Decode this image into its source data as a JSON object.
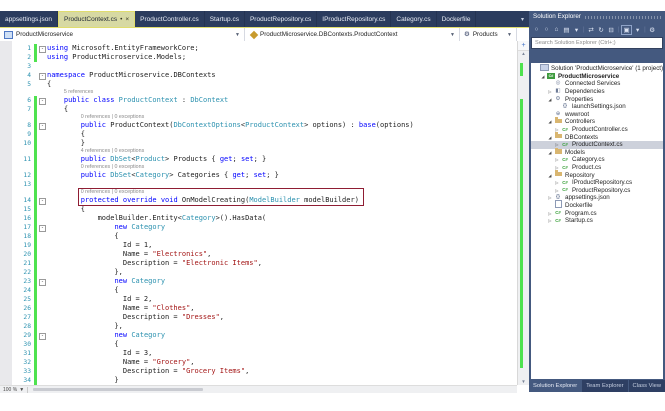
{
  "tabs": [
    {
      "label": "appsettings.json",
      "active": false
    },
    {
      "label": "ProductContext.cs",
      "active": true
    },
    {
      "label": "ProductController.cs",
      "active": false
    },
    {
      "label": "Startup.cs",
      "active": false
    },
    {
      "label": "ProductRepository.cs",
      "active": false
    },
    {
      "label": "IProductRepository.cs",
      "active": false
    },
    {
      "label": "Category.cs",
      "active": false
    },
    {
      "label": "Dockerfile",
      "active": false
    }
  ],
  "navbar": {
    "project": "ProductMicroservice",
    "type_name": "ProductMicroservice.DBContexts.ProductContext",
    "member": "Products"
  },
  "editor": {
    "zoom_level": "100 %",
    "colors": {
      "keyword": "#0000FF",
      "type": "#2B91AF",
      "string": "#A31515",
      "plain": "#1E1E1E",
      "line_number": "#2B91AF",
      "change_bar": "#4FE24F",
      "annotation_box": "#8F1D33",
      "active_tab": "#D7D9A3",
      "tab_bar": "#2B3C5E"
    },
    "rows": [
      {
        "n": 1,
        "chg": true,
        "fold": true,
        "t": [
          [
            "k",
            "using"
          ],
          [
            "p",
            " Microsoft.EntityFrameworkCore;"
          ]
        ]
      },
      {
        "n": 2,
        "chg": true,
        "t": [
          [
            "k",
            "using"
          ],
          [
            "p",
            " ProductMicroservice.Models;"
          ]
        ]
      },
      {
        "n": 3,
        "t": []
      },
      {
        "n": 4,
        "fold": true,
        "t": [
          [
            "k",
            "namespace"
          ],
          [
            "p",
            " ProductMicroservice.DBContexts"
          ]
        ]
      },
      {
        "n": 5,
        "t": [
          [
            "p",
            "{"
          ]
        ]
      },
      {
        "cl": "5 references",
        "ind": 4
      },
      {
        "n": 6,
        "chg": true,
        "fold": true,
        "t": [
          [
            "p",
            "    "
          ],
          [
            "k",
            "public"
          ],
          [
            "p",
            " "
          ],
          [
            "k",
            "class"
          ],
          [
            "p",
            " "
          ],
          [
            "t",
            "ProductContext"
          ],
          [
            "p",
            " : "
          ],
          [
            "t",
            "DbContext"
          ]
        ]
      },
      {
        "n": 7,
        "chg": true,
        "t": [
          [
            "p",
            "    {"
          ]
        ]
      },
      {
        "cl": "0 references | 0 exceptions",
        "ind": 8,
        "chg": true
      },
      {
        "n": 8,
        "chg": true,
        "fold": true,
        "t": [
          [
            "p",
            "        "
          ],
          [
            "k",
            "public"
          ],
          [
            "p",
            " ProductContext("
          ],
          [
            "t",
            "DbContextOptions"
          ],
          [
            "p",
            "<"
          ],
          [
            "t",
            "ProductContext"
          ],
          [
            "p",
            "> options) : "
          ],
          [
            "k",
            "base"
          ],
          [
            "p",
            "(options)"
          ]
        ]
      },
      {
        "n": 9,
        "chg": true,
        "t": [
          [
            "p",
            "        {"
          ]
        ]
      },
      {
        "n": 10,
        "chg": true,
        "t": [
          [
            "p",
            "        }"
          ]
        ]
      },
      {
        "cl": "4 references | 0 exceptions",
        "ind": 8,
        "chg": true
      },
      {
        "n": 11,
        "chg": true,
        "t": [
          [
            "p",
            "        "
          ],
          [
            "k",
            "public"
          ],
          [
            "p",
            " "
          ],
          [
            "t",
            "DbSet"
          ],
          [
            "p",
            "<"
          ],
          [
            "t",
            "Product"
          ],
          [
            "p",
            "> Products { "
          ],
          [
            "k",
            "get"
          ],
          [
            "p",
            "; "
          ],
          [
            "k",
            "set"
          ],
          [
            "p",
            "; }"
          ]
        ]
      },
      {
        "cl": "0 references | 0 exceptions",
        "ind": 8,
        "chg": true
      },
      {
        "n": 12,
        "chg": true,
        "t": [
          [
            "p",
            "        "
          ],
          [
            "k",
            "public"
          ],
          [
            "p",
            " "
          ],
          [
            "t",
            "DbSet"
          ],
          [
            "p",
            "<"
          ],
          [
            "t",
            "Category"
          ],
          [
            "p",
            "> Categories { "
          ],
          [
            "k",
            "get"
          ],
          [
            "p",
            "; "
          ],
          [
            "k",
            "set"
          ],
          [
            "p",
            "; }"
          ]
        ]
      },
      {
        "n": 13,
        "chg": true,
        "t": []
      },
      {
        "cl": "0 references | 0 exceptions",
        "ind": 8,
        "chg": true,
        "box": "top"
      },
      {
        "n": 14,
        "chg": true,
        "fold": true,
        "box": "main",
        "t": [
          [
            "p",
            "        "
          ],
          [
            "k",
            "protected"
          ],
          [
            "p",
            " "
          ],
          [
            "k",
            "override"
          ],
          [
            "p",
            " "
          ],
          [
            "k",
            "void"
          ],
          [
            "p",
            " OnModelCreating("
          ],
          [
            "t",
            "ModelBuilder"
          ],
          [
            "p",
            " modelBuilder)"
          ]
        ]
      },
      {
        "n": 15,
        "chg": true,
        "t": [
          [
            "p",
            "        {"
          ]
        ]
      },
      {
        "n": 16,
        "chg": true,
        "t": [
          [
            "p",
            "            modelBuilder.Entity<"
          ],
          [
            "t",
            "Category"
          ],
          [
            "p",
            ">().HasData("
          ]
        ]
      },
      {
        "n": 17,
        "chg": true,
        "fold": true,
        "t": [
          [
            "p",
            "                "
          ],
          [
            "k",
            "new"
          ],
          [
            "p",
            " "
          ],
          [
            "t",
            "Category"
          ]
        ]
      },
      {
        "n": 18,
        "chg": true,
        "t": [
          [
            "p",
            "                {"
          ]
        ]
      },
      {
        "n": 19,
        "chg": true,
        "t": [
          [
            "p",
            "                  Id = 1,"
          ]
        ]
      },
      {
        "n": 20,
        "chg": true,
        "t": [
          [
            "p",
            "                  Name = "
          ],
          [
            "s",
            "\"Electronics\""
          ],
          [
            "p",
            ","
          ]
        ]
      },
      {
        "n": 21,
        "chg": true,
        "t": [
          [
            "p",
            "                  Description = "
          ],
          [
            "s",
            "\"Electronic Items\""
          ],
          [
            "p",
            ","
          ]
        ]
      },
      {
        "n": 22,
        "chg": true,
        "t": [
          [
            "p",
            "                },"
          ]
        ]
      },
      {
        "n": 23,
        "chg": true,
        "fold": true,
        "t": [
          [
            "p",
            "                "
          ],
          [
            "k",
            "new"
          ],
          [
            "p",
            " "
          ],
          [
            "t",
            "Category"
          ]
        ]
      },
      {
        "n": 24,
        "chg": true,
        "t": [
          [
            "p",
            "                {"
          ]
        ]
      },
      {
        "n": 25,
        "chg": true,
        "t": [
          [
            "p",
            "                  Id = 2,"
          ]
        ]
      },
      {
        "n": 26,
        "chg": true,
        "t": [
          [
            "p",
            "                  Name = "
          ],
          [
            "s",
            "\"Clothes\""
          ],
          [
            "p",
            ","
          ]
        ]
      },
      {
        "n": 27,
        "chg": true,
        "t": [
          [
            "p",
            "                  Description = "
          ],
          [
            "s",
            "\"Dresses\""
          ],
          [
            "p",
            ","
          ]
        ]
      },
      {
        "n": 28,
        "chg": true,
        "t": [
          [
            "p",
            "                },"
          ]
        ]
      },
      {
        "n": 29,
        "chg": true,
        "fold": true,
        "t": [
          [
            "p",
            "                "
          ],
          [
            "k",
            "new"
          ],
          [
            "p",
            " "
          ],
          [
            "t",
            "Category"
          ]
        ]
      },
      {
        "n": 30,
        "chg": true,
        "t": [
          [
            "p",
            "                {"
          ]
        ]
      },
      {
        "n": 31,
        "chg": true,
        "t": [
          [
            "p",
            "                  Id = 3,"
          ]
        ]
      },
      {
        "n": 32,
        "chg": true,
        "t": [
          [
            "p",
            "                  Name = "
          ],
          [
            "s",
            "\"Grocery\""
          ],
          [
            "p",
            ","
          ]
        ]
      },
      {
        "n": 33,
        "chg": true,
        "t": [
          [
            "p",
            "                  Description = "
          ],
          [
            "s",
            "\"Grocery Items\""
          ],
          [
            "p",
            ","
          ]
        ]
      },
      {
        "n": 34,
        "chg": true,
        "t": [
          [
            "p",
            "                }"
          ]
        ]
      }
    ]
  },
  "solution_explorer": {
    "title": "Solution Explorer",
    "search_placeholder": "Search Solution Explorer (Ctrl+;)",
    "toolbar_icons": [
      {
        "glyph": "○",
        "name": "back-icon"
      },
      {
        "glyph": "○",
        "name": "forward-icon"
      },
      {
        "glyph": "⌂",
        "name": "home-icon"
      },
      {
        "glyph": "▤",
        "name": "switch-views-icon"
      },
      {
        "glyph": "▾",
        "name": "switch-views-dropdown-icon"
      },
      {
        "glyph": "|",
        "name": "separator"
      },
      {
        "glyph": "⇄",
        "name": "sync-with-active-document-icon"
      },
      {
        "glyph": "↻",
        "name": "refresh-icon"
      },
      {
        "glyph": "⊟",
        "name": "collapse-all-icon"
      },
      {
        "glyph": "|",
        "name": "separator"
      },
      {
        "glyph": "▣",
        "name": "show-all-files-icon"
      },
      {
        "glyph": "▾",
        "name": "filter-dropdown-icon"
      },
      {
        "glyph": "|",
        "name": "separator"
      },
      {
        "glyph": "⚙",
        "name": "properties-icon"
      }
    ],
    "items": [
      {
        "label": "Solution 'ProductMicroservice' (1 project)",
        "icon": "solution",
        "indent": 0
      },
      {
        "label": "ProductMicroservice",
        "icon": "csproj",
        "indent": 1,
        "expander": "expanded",
        "bold": true
      },
      {
        "label": "Connected Services",
        "icon": "connected-services",
        "indent": 2
      },
      {
        "label": "Dependencies",
        "icon": "dependencies",
        "indent": 2,
        "expander": "collapsed"
      },
      {
        "label": "Properties",
        "icon": "properties",
        "indent": 2,
        "expander": "expanded"
      },
      {
        "label": "launchSettings.json",
        "icon": "json",
        "indent": 3
      },
      {
        "label": "wwwroot",
        "icon": "wwwroot",
        "indent": 2
      },
      {
        "label": "Controllers",
        "icon": "folder",
        "indent": 2,
        "expander": "expanded"
      },
      {
        "label": "ProductController.cs",
        "icon": "cs",
        "indent": 3,
        "expander": "collapsed"
      },
      {
        "label": "DBContexts",
        "icon": "folder",
        "indent": 2,
        "expander": "expanded"
      },
      {
        "label": "ProductContext.cs",
        "icon": "cs",
        "indent": 3,
        "expander": "collapsed",
        "selected": true
      },
      {
        "label": "Models",
        "icon": "folder",
        "indent": 2,
        "expander": "expanded"
      },
      {
        "label": "Category.cs",
        "icon": "cs",
        "indent": 3,
        "expander": "collapsed"
      },
      {
        "label": "Product.cs",
        "icon": "cs",
        "indent": 3,
        "expander": "collapsed"
      },
      {
        "label": "Repository",
        "icon": "folder",
        "indent": 2,
        "expander": "expanded"
      },
      {
        "label": "IProductRepository.cs",
        "icon": "cs",
        "indent": 3,
        "expander": "collapsed"
      },
      {
        "label": "ProductRepository.cs",
        "icon": "cs",
        "indent": 3,
        "expander": "collapsed"
      },
      {
        "label": "appsettings.json",
        "icon": "json",
        "indent": 2,
        "expander": "collapsed"
      },
      {
        "label": "Dockerfile",
        "icon": "file",
        "indent": 2
      },
      {
        "label": "Program.cs",
        "icon": "cs",
        "indent": 2,
        "expander": "collapsed"
      },
      {
        "label": "Startup.cs",
        "icon": "cs",
        "indent": 2,
        "expander": "collapsed"
      }
    ],
    "bottom_tabs": [
      {
        "label": "Solution Explorer",
        "active": true
      },
      {
        "label": "Team Explorer",
        "active": false
      },
      {
        "label": "Class View",
        "active": false
      }
    ]
  }
}
